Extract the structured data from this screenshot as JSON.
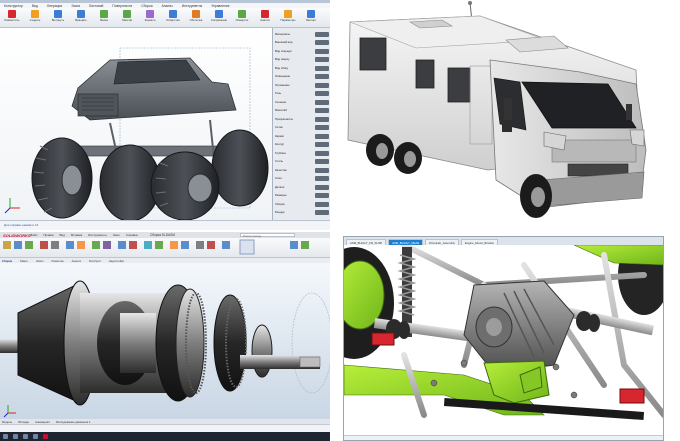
{
  "monster_truck_cad": {
    "ribbon_tabs": [
      "Конструктор",
      "Вид",
      "Операции",
      "Эскиз",
      "Листовой",
      "Поверхности",
      "Сборка",
      "Анализ",
      "Инструменты",
      "Управление"
    ],
    "ribbon_buttons": [
      {
        "label": "Разместить",
        "color": "#d8262e"
      },
      {
        "label": "Создать",
        "color": "#f0a020"
      },
      {
        "label": "Вытянуть",
        "color": "#3d7dd8"
      },
      {
        "label": "Вращать",
        "color": "#3d7dd8"
      },
      {
        "label": "Фаска",
        "color": "#5aa845"
      },
      {
        "label": "Массив",
        "color": "#5aa845"
      },
      {
        "label": "Зеркало",
        "color": "#9a6ad0"
      },
      {
        "label": "Отверстие",
        "color": "#3d7dd8"
      },
      {
        "label": "Оболочка",
        "color": "#e07b22"
      },
      {
        "label": "Сопряжение",
        "color": "#3d7dd8"
      },
      {
        "label": "Измерить",
        "color": "#5aa845"
      },
      {
        "label": "Анализ",
        "color": "#d8262e"
      },
      {
        "label": "Параметры",
        "color": "#f0a020"
      },
      {
        "label": "Экспорт",
        "color": "#3d7dd8"
      }
    ],
    "panel_rows": [
      "Материалы",
      "Внешний вид",
      "Вид спереди",
      "Вид сверху",
      "Вид сбоку",
      "Освещение",
      "Отражение",
      "Тень",
      "Сечение",
      "Масштаб",
      "Прозрачность",
      "Сетка",
      "Каркас",
      "Контур",
      "Глубина",
      "Стиль",
      "Качество",
      "Слои",
      "Детали",
      "Размеры",
      "Сборка",
      "Рендер"
    ],
    "status_text": "Для справки нажмите F1"
  },
  "gearbox_solidworks": {
    "brand": "SOLIDWORKS",
    "menu": [
      "Файл",
      "Правка",
      "Вид",
      "Вставка",
      "Инструменты",
      "Окно",
      "Справка"
    ],
    "doc_title": "Сборка.SLDASM",
    "search_placeholder": "Поиск команд",
    "cm_tabs": [
      {
        "label": "Сборка",
        "active": true
      },
      {
        "label": "Макет",
        "active": false
      },
      {
        "label": "Эскиз",
        "active": false
      },
      {
        "label": "Разметка",
        "active": false
      },
      {
        "label": "Анализ",
        "active": false
      },
      {
        "label": "DimXpert",
        "active": false
      },
      {
        "label": "Надстройки",
        "active": false
      }
    ],
    "bottom_tabs": [
      "Модель",
      "3D виды",
      "Анимация1",
      "Исследование движения 1"
    ]
  },
  "buggy_cad": {
    "doc_tabs": [
      {
        "label": "ASM_BUGGY_FR_SUSP",
        "active": false
      },
      {
        "label": "ASM_BUGGY_REAR",
        "active": true
      },
      {
        "label": "Drivetrain_Assembly",
        "active": false
      },
      {
        "label": "Engine_Mount_Bracket",
        "active": false
      }
    ]
  }
}
